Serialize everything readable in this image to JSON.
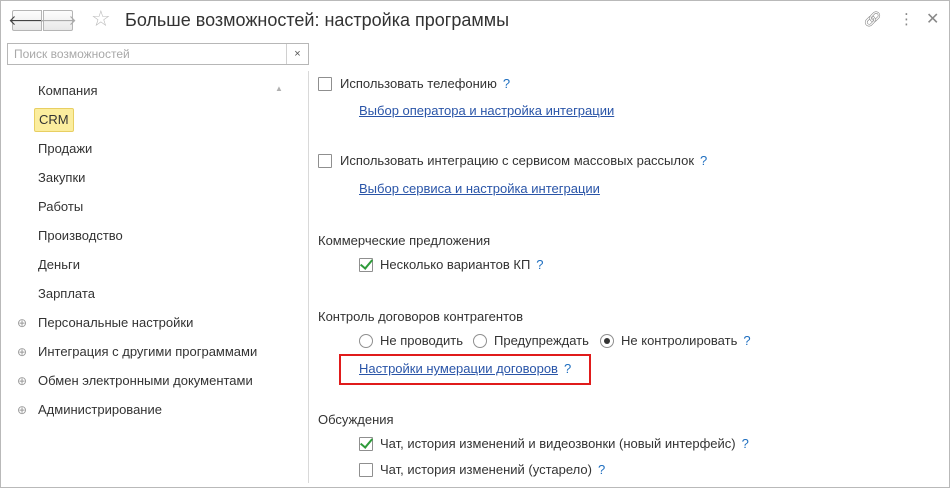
{
  "window": {
    "title": "Больше возможностей: настройка программы",
    "nav_back": "🡐",
    "nav_forward": "🡒",
    "icons": {
      "favorite": "star-icon",
      "link": "link-icon",
      "more": "more-icon",
      "close": "close-icon"
    }
  },
  "search": {
    "placeholder": "Поиск возможностей",
    "value": "",
    "clear": "×"
  },
  "sidebar": {
    "items": [
      {
        "label": "Компания"
      },
      {
        "label": "CRM",
        "selected": true
      },
      {
        "label": "Продажи"
      },
      {
        "label": "Закупки"
      },
      {
        "label": "Работы"
      },
      {
        "label": "Производство"
      },
      {
        "label": "Деньги"
      },
      {
        "label": "Зарплата"
      }
    ],
    "groups": [
      {
        "label": "Персональные настройки"
      },
      {
        "label": "Интеграция с другими программами"
      },
      {
        "label": "Обмен электронными документами"
      },
      {
        "label": "Администрирование"
      }
    ]
  },
  "content": {
    "telephony": {
      "label": "Использовать телефонию",
      "checked": false,
      "link": "Выбор оператора и настройка интеграции"
    },
    "mailing": {
      "label": "Использовать интеграцию с сервисом массовых рассылок",
      "checked": false,
      "link": "Выбор сервиса и настройка интеграции"
    },
    "offers": {
      "title": "Коммерческие предложения",
      "option_label": "Несколько вариантов КП",
      "checked": true
    },
    "contracts": {
      "title": "Контроль договоров контрагентов",
      "options": [
        "Не проводить",
        "Предупреждать",
        "Не контролировать"
      ],
      "selected_index": 2,
      "link": "Настройки нумерации договоров"
    },
    "discussions": {
      "title": "Обсуждения",
      "option1": "Чат, история изменений и видеозвонки (новый интерфейс)",
      "option1_checked": true,
      "option2": "Чат, история изменений (устарело)",
      "option2_checked": false
    },
    "help_mark": "?"
  },
  "colors": {
    "selected_bg": "#fbed9e",
    "link": "#2a55a8",
    "help": "#1f6fc0",
    "check": "#2e9b3a",
    "highlight": "#e01b1b"
  }
}
